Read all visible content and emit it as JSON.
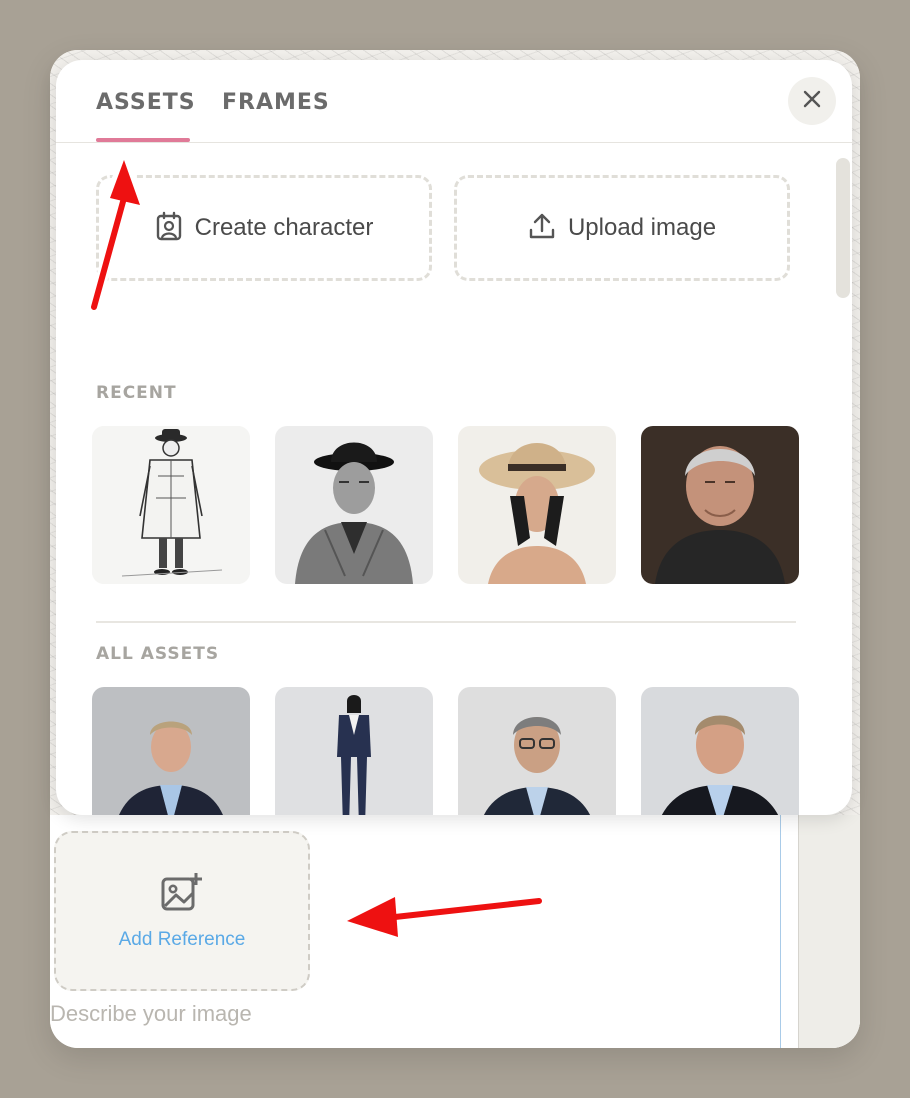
{
  "tabs": [
    {
      "label": "ASSETS",
      "active": true
    },
    {
      "label": "FRAMES",
      "active": false
    }
  ],
  "actions": {
    "create_character": "Create character",
    "upload_image": "Upload image"
  },
  "sections": {
    "recent": "RECENT",
    "all_assets": "ALL ASSETS"
  },
  "icons": {
    "close": "close-icon",
    "create_character": "user-portrait-icon",
    "upload_image": "upload-icon",
    "add_reference": "image-add-icon"
  },
  "recent_assets": [
    "sketch-detective",
    "older-man-fedora",
    "woman-sun-hat",
    "grey-haired-man"
  ],
  "all_assets": [
    "man-navy-blazer",
    "woman-navy-suit",
    "man-glasses-suit",
    "man-dark-blazer"
  ],
  "reference": {
    "label": "Add Reference"
  },
  "prompt": {
    "placeholder": "Describe your image"
  },
  "colors": {
    "accent_tab": "#e07a98",
    "link_blue": "#5aa9e6",
    "annotation_red": "#ee1111"
  }
}
